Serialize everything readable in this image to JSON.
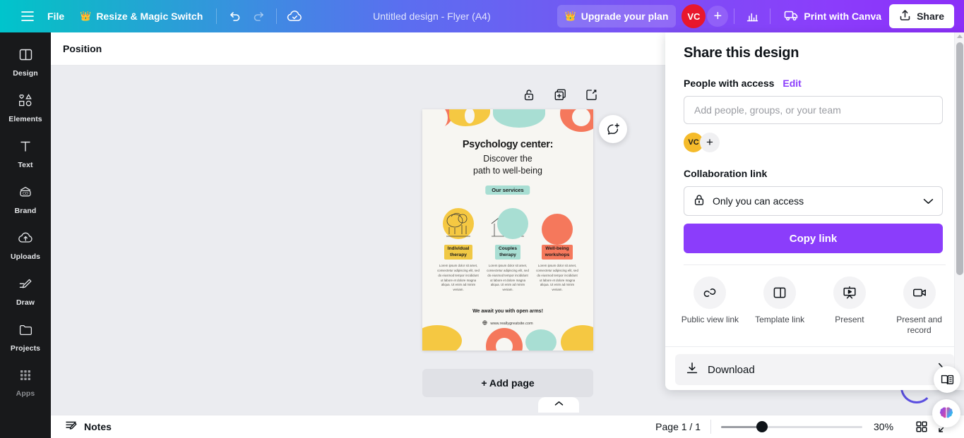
{
  "topbar": {
    "menu_icon": "hamburger-icon",
    "file_label": "File",
    "resize_label": "Resize & Magic Switch",
    "resize_icon": "crown-icon",
    "undo_icon": "undo-icon",
    "redo_icon": "redo-icon",
    "cloud_icon": "cloud-saved-icon",
    "doc_title": "Untitled design - Flyer (A4)",
    "upgrade_label": "Upgrade your plan",
    "upgrade_icon": "crown-icon",
    "avatar_initials": "VC",
    "avatar_color": "#e8172d",
    "plus_label": "+",
    "stats_icon": "bar-chart-icon",
    "print_label": "Print with Canva",
    "print_icon": "truck-icon",
    "share_label": "Share",
    "share_icon": "share-upload-icon",
    "gradient_start": "#00c4cc",
    "gradient_end": "#8b2ff8"
  },
  "sidebar": {
    "items": [
      {
        "label": "Design",
        "icon": "layout-panels-icon",
        "dim": false
      },
      {
        "label": "Elements",
        "icon": "shapes-icon",
        "dim": false
      },
      {
        "label": "Text",
        "icon": "text-t-icon",
        "dim": false
      },
      {
        "label": "Brand",
        "icon": "brand-badge-icon",
        "dim": false
      },
      {
        "label": "Uploads",
        "icon": "upload-cloud-icon",
        "dim": false
      },
      {
        "label": "Draw",
        "icon": "pencil-draw-icon",
        "dim": false
      },
      {
        "label": "Projects",
        "icon": "folder-icon",
        "dim": false
      },
      {
        "label": "Apps",
        "icon": "grid-dots-icon",
        "dim": true
      }
    ]
  },
  "positionbar": {
    "label": "Position"
  },
  "canvas": {
    "page_tools": [
      {
        "name": "unlock-icon",
        "label": "Unlock"
      },
      {
        "name": "duplicate-page-icon",
        "label": "Duplicate page"
      },
      {
        "name": "add-page-icon",
        "label": "Add page"
      }
    ],
    "comment_icon": "comment-add-icon",
    "add_page_label": "+ Add page",
    "collapse_icon": "chevron-up-icon"
  },
  "flyer": {
    "title": "Psychology center:",
    "subtitle_line1": "Discover the",
    "subtitle_line2": "path to well-being",
    "services_pill": "Our services",
    "services": [
      {
        "tag_line1": "Individual",
        "tag_line2": "therapy",
        "tag_color": "#f0c845",
        "circle_color": "#f5c842",
        "body": "Lorem ipsum dolor sit amet, consectetur adipiscing elit, sed do eiusmod tempor incididunt ut labore et dolore magna aliqua. Ut enim ad minim veniam."
      },
      {
        "tag_line1": "Couples",
        "tag_line2": "therapy",
        "tag_color": "#a8ded3",
        "circle_color": "#a8ded3",
        "body": "Lorem ipsum dolor sit amet, consectetur adipiscing elit, sed do eiusmod tempor incididunt ut labore et dolore magna aliqua. Ut enim ad minim veniam."
      },
      {
        "tag_line1": "Well-being",
        "tag_line2": "workshops",
        "tag_color": "#f5785c",
        "circle_color": "#f5785c",
        "body": "Lorem ipsum dolor sit amet, consectetur adipiscing elit, sed do eiusmod tempor incididunt ut labore et dolore magna aliqua. Ut enim ad minim veniam."
      }
    ],
    "closing": "We await you with open arms!",
    "website": "www.reallygreatsite.com",
    "website_icon": "globe-icon"
  },
  "share_panel": {
    "title": "Share this design",
    "people_label": "People with access",
    "edit_label": "Edit",
    "input_placeholder": "Add people, groups, or your team",
    "input_value": "",
    "avatar_initials": "VC",
    "avatar_color": "#f5bb2b",
    "add_person_label": "+",
    "collab_label": "Collaboration link",
    "access_value": "Only you can access",
    "access_icon": "lock-icon",
    "chevron_icon": "chevron-down-icon",
    "copy_label": "Copy link",
    "copy_color": "#8b3dfb",
    "actions": [
      {
        "label": "Public view link",
        "icon": "link-chain-icon"
      },
      {
        "label": "Template link",
        "icon": "template-panels-icon"
      },
      {
        "label": "Present",
        "icon": "presentation-icon"
      },
      {
        "label": "Present and record",
        "icon": "video-camera-icon"
      }
    ],
    "download_label": "Download",
    "download_icon": "download-arrow-icon",
    "download_chevron": "chevron-right-icon"
  },
  "bottombar": {
    "notes_label": "Notes",
    "notes_icon": "notes-pencil-icon",
    "page_count": "Page 1 / 1",
    "zoom_value": "30%",
    "zoom_percent": 30,
    "grid_icon": "grid-view-icon",
    "fullscreen_icon": "expand-fullscreen-icon"
  },
  "fabs": [
    {
      "name": "docs-help-icon",
      "label": "Docs"
    },
    {
      "name": "magic-brain-icon",
      "label": "Magic"
    }
  ]
}
